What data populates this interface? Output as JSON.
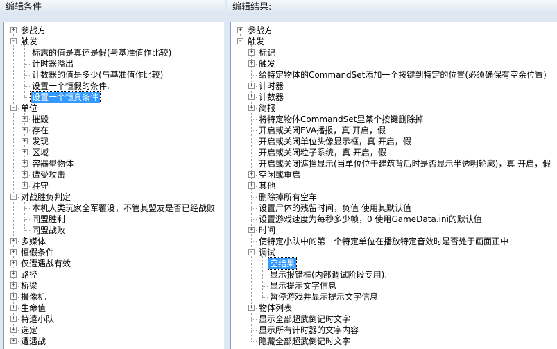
{
  "left_panel": {
    "title": "编辑条件",
    "tree": [
      {
        "label": "参战方",
        "level": 0,
        "node": "collapsed"
      },
      {
        "label": "触发",
        "level": 0,
        "node": "expanded"
      },
      {
        "label": "标志的值是真还是假(与基准值作比较)",
        "level": 1,
        "node": "leaf"
      },
      {
        "label": "计时器溢出",
        "level": 1,
        "node": "leaf"
      },
      {
        "label": "计数器的值是多少(与基准值作比较)",
        "level": 1,
        "node": "leaf"
      },
      {
        "label": "设置一个恒假的条件.",
        "level": 1,
        "node": "leaf"
      },
      {
        "label": "设置一个恒真条件",
        "level": 1,
        "node": "leaf",
        "selected": true
      },
      {
        "label": "单位",
        "level": 0,
        "node": "expanded"
      },
      {
        "label": "摧毁",
        "level": 1,
        "node": "collapsed"
      },
      {
        "label": "存在",
        "level": 1,
        "node": "collapsed"
      },
      {
        "label": "发现",
        "level": 1,
        "node": "collapsed"
      },
      {
        "label": "区域",
        "level": 1,
        "node": "collapsed"
      },
      {
        "label": "容器型物体",
        "level": 1,
        "node": "collapsed"
      },
      {
        "label": "遭受攻击",
        "level": 1,
        "node": "collapsed"
      },
      {
        "label": "驻守",
        "level": 1,
        "node": "collapsed"
      },
      {
        "label": "对战胜负判定",
        "level": 0,
        "node": "expanded"
      },
      {
        "label": "本机人类玩家全军覆没，不管其盟友是否已经战败",
        "level": 1,
        "node": "leaf"
      },
      {
        "label": "同盟胜利",
        "level": 1,
        "node": "leaf"
      },
      {
        "label": "同盟战败",
        "level": 1,
        "node": "leaf"
      },
      {
        "label": "多媒体",
        "level": 0,
        "node": "collapsed"
      },
      {
        "label": "恒假条件",
        "level": 0,
        "node": "collapsed"
      },
      {
        "label": "仅遭遇战有效",
        "level": 0,
        "node": "collapsed"
      },
      {
        "label": "路径",
        "level": 0,
        "node": "collapsed"
      },
      {
        "label": "桥梁",
        "level": 0,
        "node": "collapsed"
      },
      {
        "label": "摄像机",
        "level": 0,
        "node": "collapsed"
      },
      {
        "label": "生命值",
        "level": 0,
        "node": "collapsed"
      },
      {
        "label": "特遣小队",
        "level": 0,
        "node": "collapsed"
      },
      {
        "label": "选定",
        "level": 0,
        "node": "collapsed"
      },
      {
        "label": "遭遇战",
        "level": 0,
        "node": "collapsed"
      }
    ]
  },
  "right_panel": {
    "title": "编辑结果:",
    "tree": [
      {
        "label": "参战方",
        "level": 0,
        "node": "collapsed"
      },
      {
        "label": "触发",
        "level": 0,
        "node": "expanded"
      },
      {
        "label": "标记",
        "level": 1,
        "node": "collapsed"
      },
      {
        "label": "触发",
        "level": 1,
        "node": "collapsed"
      },
      {
        "label": "给特定物体的CommandSet添加一个按键到特定的位置(必须确保有空余位置)",
        "level": 1,
        "node": "leaf"
      },
      {
        "label": "计时器",
        "level": 1,
        "node": "collapsed"
      },
      {
        "label": "计数器",
        "level": 1,
        "node": "collapsed"
      },
      {
        "label": "简报",
        "level": 1,
        "node": "collapsed"
      },
      {
        "label": "将特定物体CommandSet里某个按键删除掉",
        "level": 1,
        "node": "leaf"
      },
      {
        "label": "开启或关闭EVA播报，真 开启，假",
        "level": 1,
        "node": "leaf"
      },
      {
        "label": "开启或关闭单位头像显示框，真 开启，假",
        "level": 1,
        "node": "leaf"
      },
      {
        "label": "开启或关闭粒子系统，真 开启，假",
        "level": 1,
        "node": "leaf"
      },
      {
        "label": "开启或关闭遮挡显示(当单位位于建筑背后时是否显示半透明轮廓)，真 开启，假",
        "level": 1,
        "node": "leaf"
      },
      {
        "label": "空闲或重启",
        "level": 1,
        "node": "collapsed"
      },
      {
        "label": "其他",
        "level": 1,
        "node": "collapsed"
      },
      {
        "label": "删除掉所有空车",
        "level": 1,
        "node": "leaf"
      },
      {
        "label": "设置尸体的残留时间，负值 使用其默认值",
        "level": 1,
        "node": "leaf"
      },
      {
        "label": "设置游戏速度为每秒多少帧，0 使用GameData.ini的默认值",
        "level": 1,
        "node": "leaf"
      },
      {
        "label": "时间",
        "level": 1,
        "node": "collapsed"
      },
      {
        "label": "使特定小队中的第一个特定单位在播放特定音效时是否处于画面正中",
        "level": 1,
        "node": "leaf"
      },
      {
        "label": "调试",
        "level": 1,
        "node": "expanded"
      },
      {
        "label": "空结果",
        "level": 2,
        "node": "leaf",
        "selected": true
      },
      {
        "label": "显示报错框(内部调试阶段专用).",
        "level": 2,
        "node": "leaf"
      },
      {
        "label": "显示提示文字信息",
        "level": 2,
        "node": "leaf"
      },
      {
        "label": "暂停游戏并显示提示文字信息",
        "level": 2,
        "node": "leaf"
      },
      {
        "label": "物体列表",
        "level": 1,
        "node": "collapsed"
      },
      {
        "label": "显示全部超武倒记时文字",
        "level": 1,
        "node": "leaf"
      },
      {
        "label": "显示所有计时器的文字内容",
        "level": 1,
        "node": "leaf"
      },
      {
        "label": "隐藏全部超武倒记时文字",
        "level": 1,
        "node": "leaf"
      }
    ]
  }
}
